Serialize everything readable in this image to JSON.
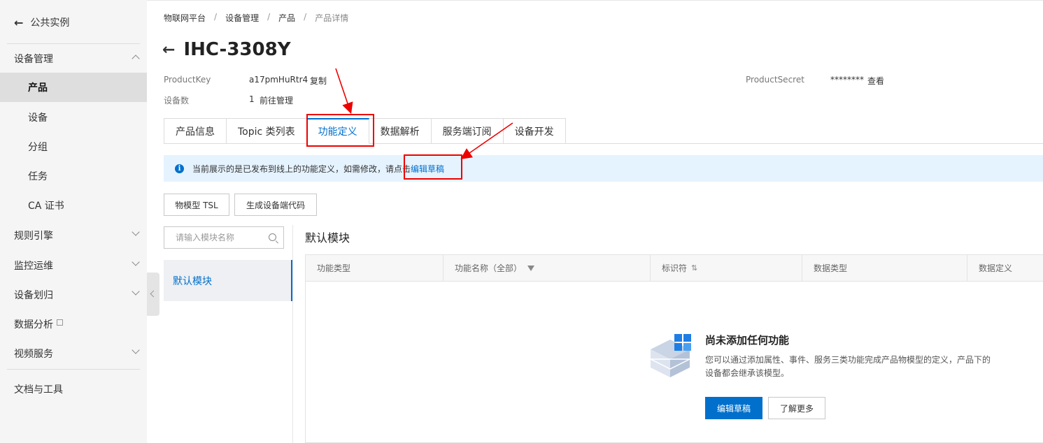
{
  "sidebar": {
    "back_label": "公共实例",
    "groups": [
      {
        "label": "设备管理",
        "expanded": true
      },
      {
        "label": "规则引擎"
      },
      {
        "label": "监控运维"
      },
      {
        "label": "设备划归"
      },
      {
        "label": "数据分析"
      },
      {
        "label": "视频服务"
      }
    ],
    "items": [
      {
        "label": "产品",
        "active": true
      },
      {
        "label": "设备"
      },
      {
        "label": "分组"
      },
      {
        "label": "任务"
      },
      {
        "label": "CA 证书"
      }
    ],
    "footer_label": "文档与工具"
  },
  "breadcrumb": [
    "物联网平台",
    "设备管理",
    "产品",
    "产品详情"
  ],
  "title": "IHC-3308Y",
  "product_key": {
    "label": "ProductKey",
    "value": "a17pmHuRtr4",
    "action": "复制"
  },
  "device_count": {
    "label": "设备数",
    "value": "1",
    "action": "前往管理"
  },
  "product_secret": {
    "label": "ProductSecret",
    "value": "********",
    "action": "查看"
  },
  "tabs": [
    "产品信息",
    "Topic 类列表",
    "功能定义",
    "数据解析",
    "服务端订阅",
    "设备开发"
  ],
  "active_tab": "功能定义",
  "notice": {
    "text": "当前展示的是已发布到线上的功能定义，如需修改，请点击",
    "link": "编辑草稿"
  },
  "toolbar": {
    "tsl": "物模型 TSL",
    "gen_code": "生成设备端代码"
  },
  "search": {
    "placeholder": "请输入模块名称"
  },
  "module": {
    "item": "默认模块",
    "title": "默认模块"
  },
  "table": {
    "headers": [
      "功能类型",
      "功能名称（全部）",
      "标识符",
      "数据类型",
      "数据定义"
    ]
  },
  "empty": {
    "title": "尚未添加任何功能",
    "desc": "您可以通过添加属性、事件、服务三类功能完成产品物模型的定义，产品下的设备都会继承该模型。",
    "primary": "编辑草稿",
    "secondary": "了解更多"
  },
  "colors": {
    "accent": "#0070cc",
    "annotation": "#e00000",
    "brand": "#ff6a00"
  }
}
